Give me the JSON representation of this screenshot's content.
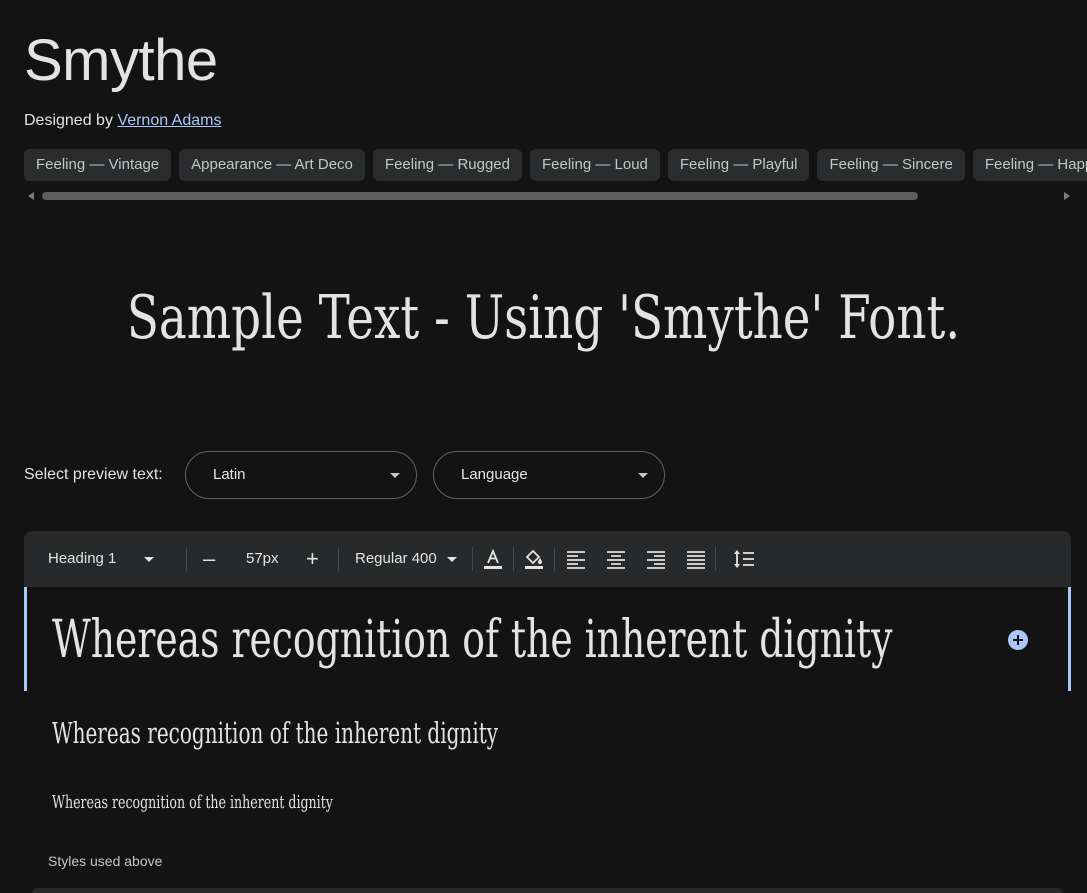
{
  "font": {
    "name": "Smythe",
    "designed_by_label": "Designed by",
    "designer": "Vernon Adams"
  },
  "tags": [
    "Feeling — Vintage",
    "Appearance — Art Deco",
    "Feeling — Rugged",
    "Feeling — Loud",
    "Feeling — Playful",
    "Feeling — Sincere",
    "Feeling — Happy"
  ],
  "banner": {
    "text": "Sample Text - Using 'Smythe' Font."
  },
  "preview": {
    "label": "Select preview text:",
    "script_value": "Latin",
    "language_value": "Language"
  },
  "toolbar": {
    "style_value": "Heading 1",
    "size_value": "57px",
    "weight_value": "Regular 400",
    "minus_label": "–",
    "plus_label": "+"
  },
  "samples": [
    "Whereas recognition of the inherent dignity",
    "Whereas recognition of the inherent dignity",
    "Whereas recognition of the inherent dignity"
  ],
  "styles_used_label": "Styles used above",
  "colors": {
    "background": "#131314",
    "accent": "#a8c7fa",
    "toolbar": "#28292a",
    "chip": "#2b2c2e"
  }
}
